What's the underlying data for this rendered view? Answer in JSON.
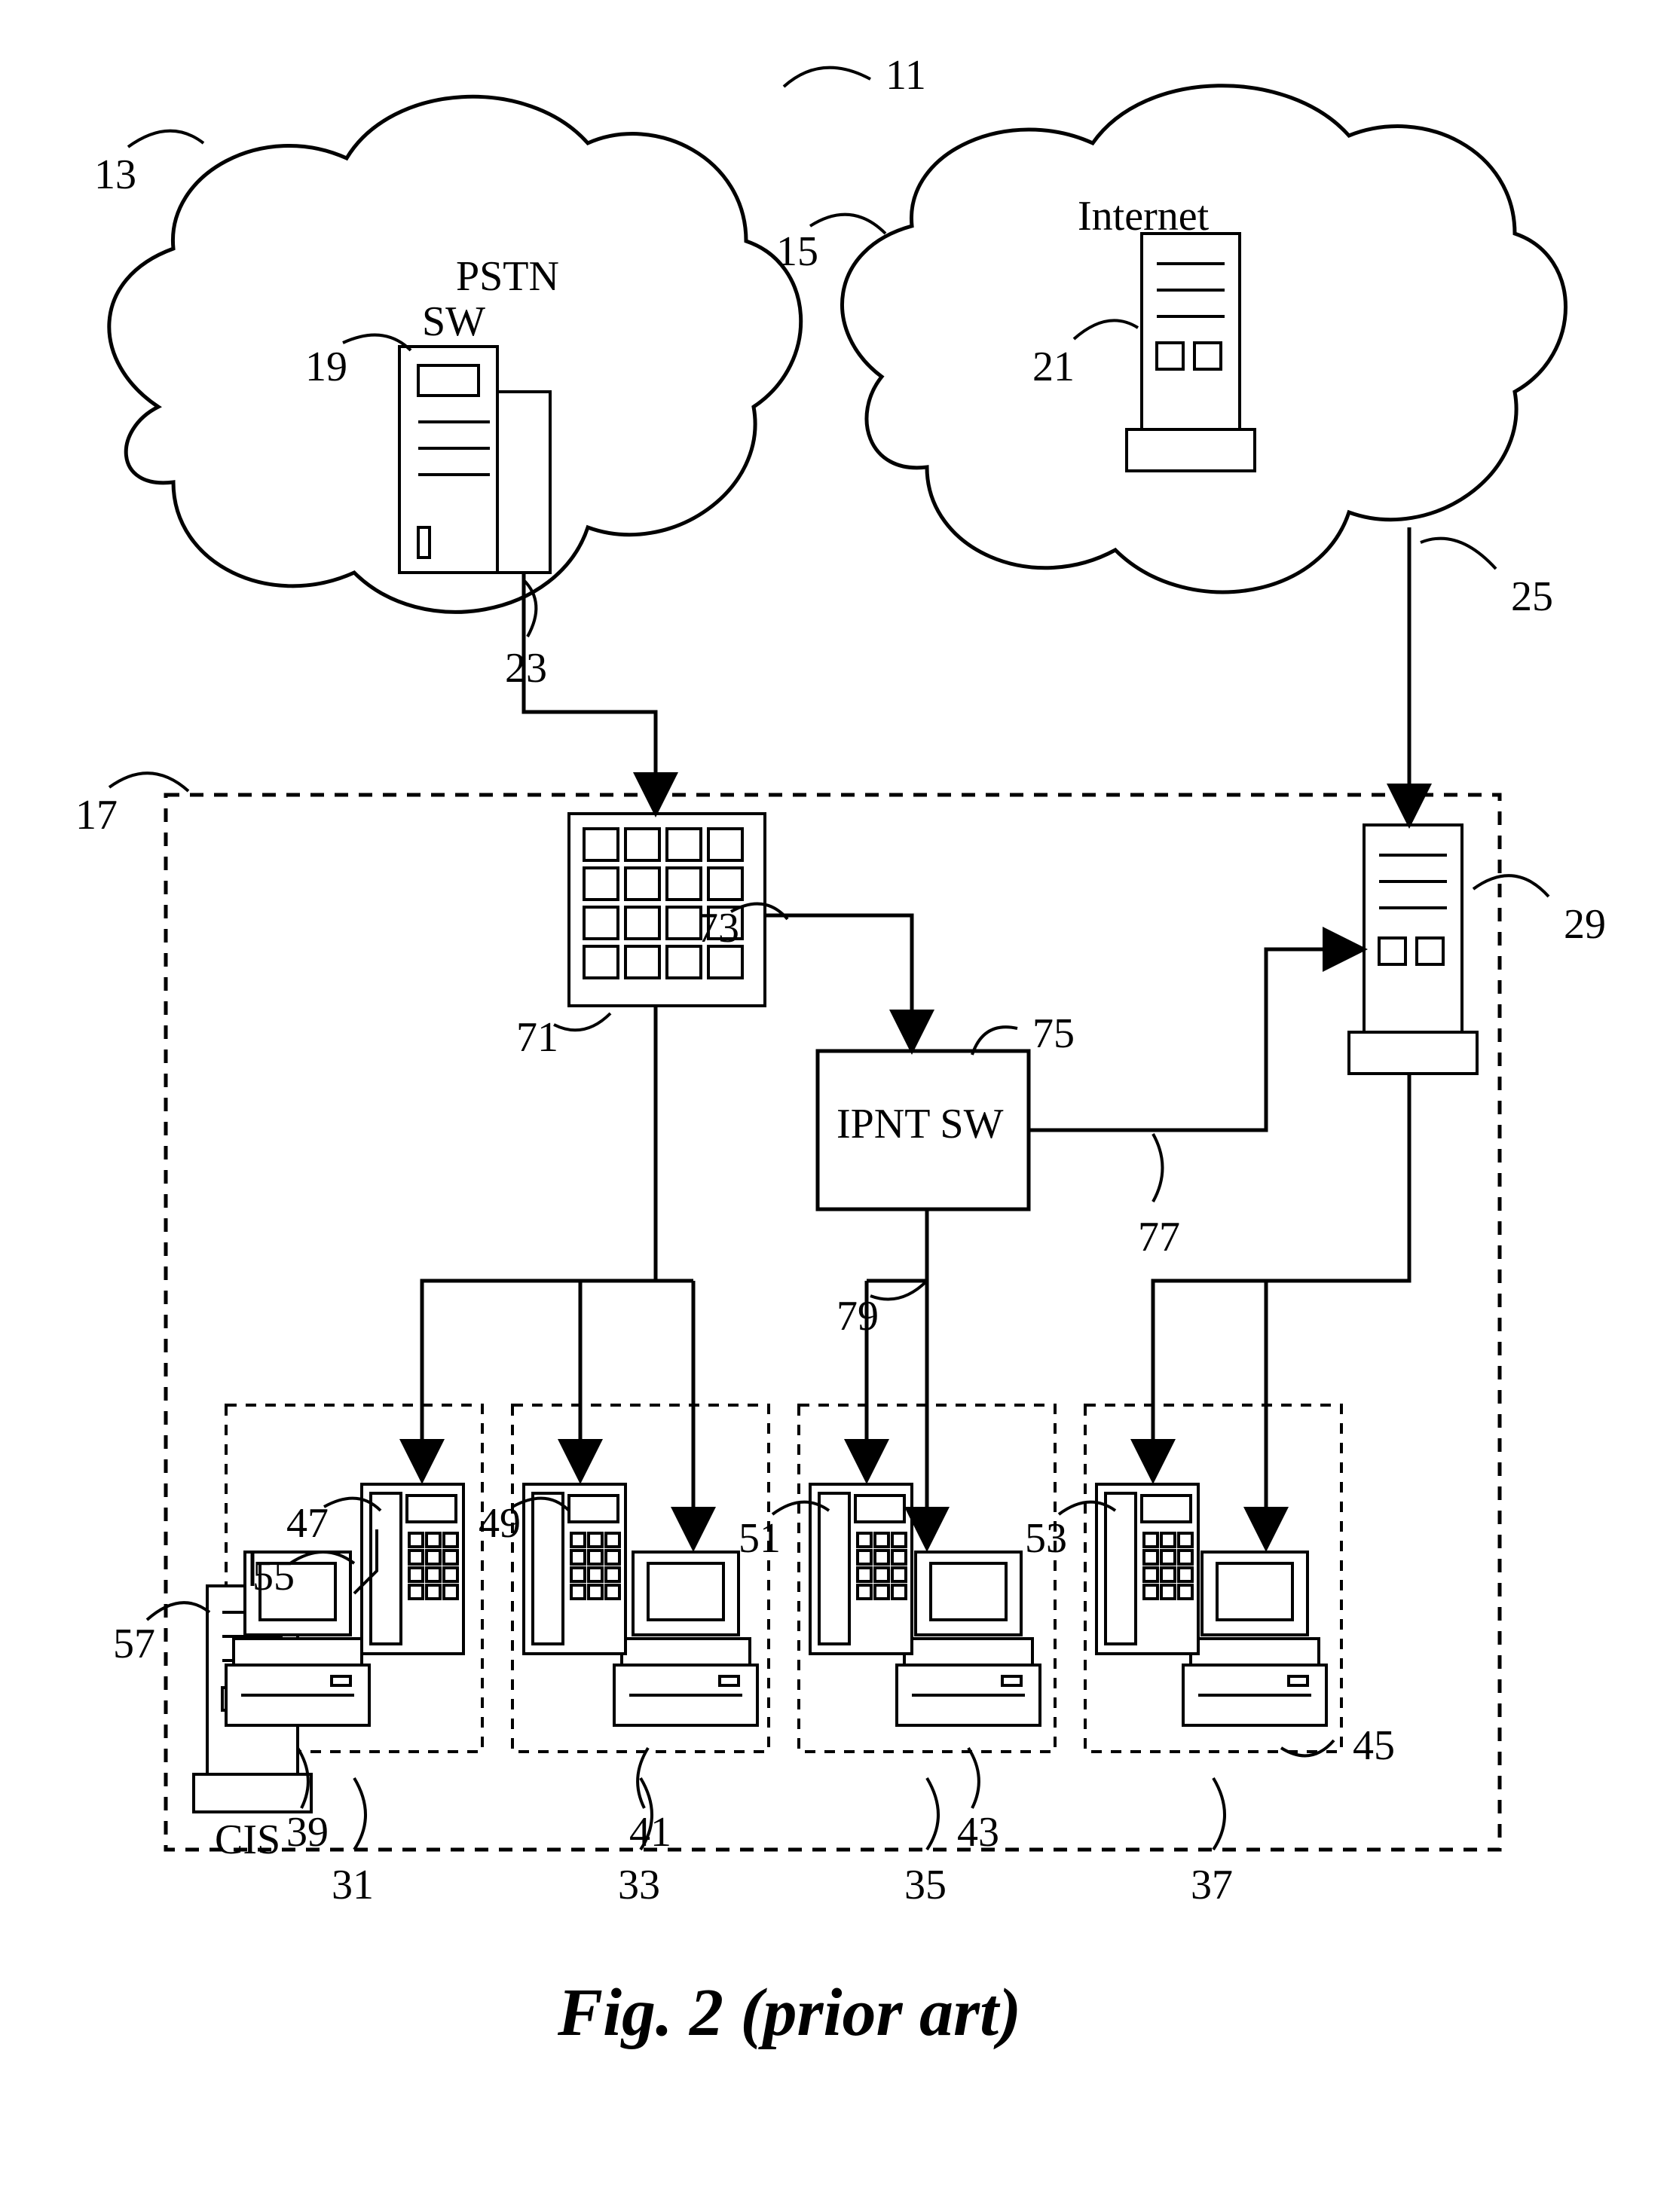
{
  "text": {
    "pstn": "PSTN",
    "internet": "Internet",
    "sw": "SW",
    "ipnt_sw": "IPNT SW",
    "cis": "CIS",
    "caption": "Fig. 2 (prior art)"
  },
  "refs": {
    "r11": "11",
    "r13": "13",
    "r15": "15",
    "r17": "17",
    "r19": "19",
    "r21": "21",
    "r23": "23",
    "r25": "25",
    "r29": "29",
    "r31": "31",
    "r33": "33",
    "r35": "35",
    "r37": "37",
    "r39": "39",
    "r41": "41",
    "r43": "43",
    "r45": "45",
    "r47": "47",
    "r49": "49",
    "r51": "51",
    "r53": "53",
    "r55": "55",
    "r57": "57",
    "r71": "71",
    "r73": "73",
    "r75": "75",
    "r77": "77",
    "r79": "79"
  }
}
